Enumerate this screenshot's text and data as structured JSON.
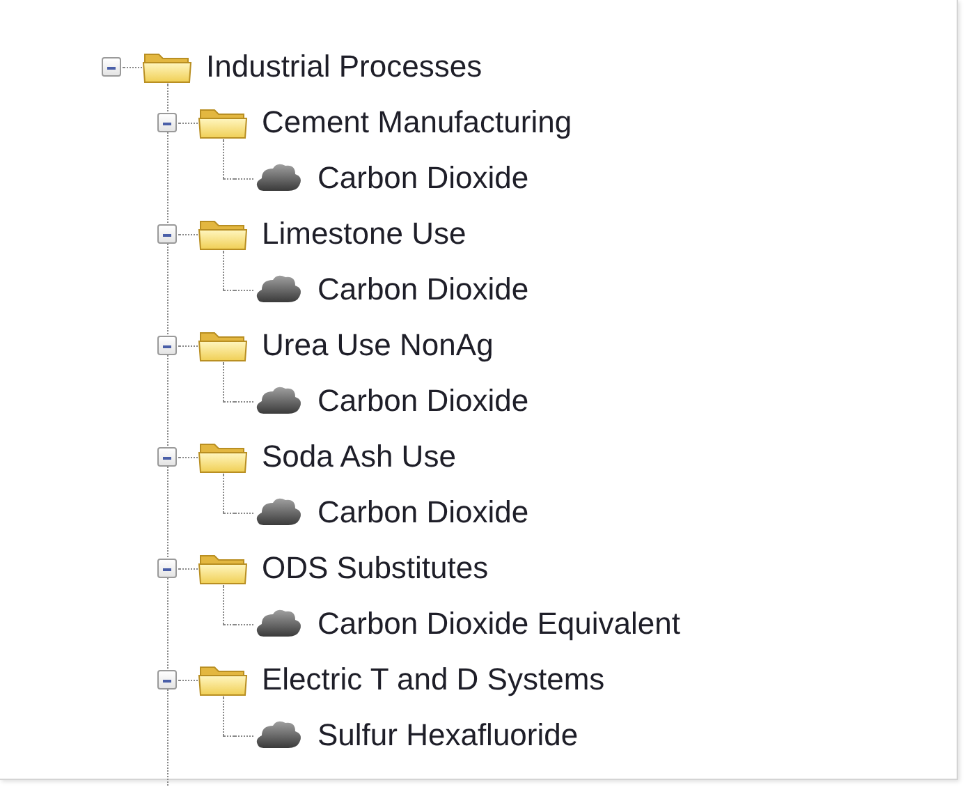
{
  "tree": [
    {
      "label": "Industrial Processes",
      "kind": "folder",
      "expanded": true,
      "children": [
        {
          "label": "Cement Manufacturing",
          "kind": "folder",
          "expanded": true,
          "children": [
            {
              "label": "Carbon Dioxide",
              "kind": "gas"
            }
          ]
        },
        {
          "label": "Limestone Use",
          "kind": "folder",
          "expanded": true,
          "children": [
            {
              "label": "Carbon Dioxide",
              "kind": "gas"
            }
          ]
        },
        {
          "label": "Urea Use NonAg",
          "kind": "folder",
          "expanded": true,
          "children": [
            {
              "label": "Carbon Dioxide",
              "kind": "gas"
            }
          ]
        },
        {
          "label": "Soda Ash Use",
          "kind": "folder",
          "expanded": true,
          "children": [
            {
              "label": "Carbon Dioxide",
              "kind": "gas"
            }
          ]
        },
        {
          "label": "ODS Substitutes",
          "kind": "folder",
          "expanded": true,
          "children": [
            {
              "label": "Carbon Dioxide Equivalent",
              "kind": "gas"
            }
          ]
        },
        {
          "label": "Electric T and D Systems",
          "kind": "folder",
          "expanded": true,
          "children": [
            {
              "label": "Sulfur Hexafluoride",
              "kind": "gas"
            }
          ]
        }
      ]
    }
  ]
}
